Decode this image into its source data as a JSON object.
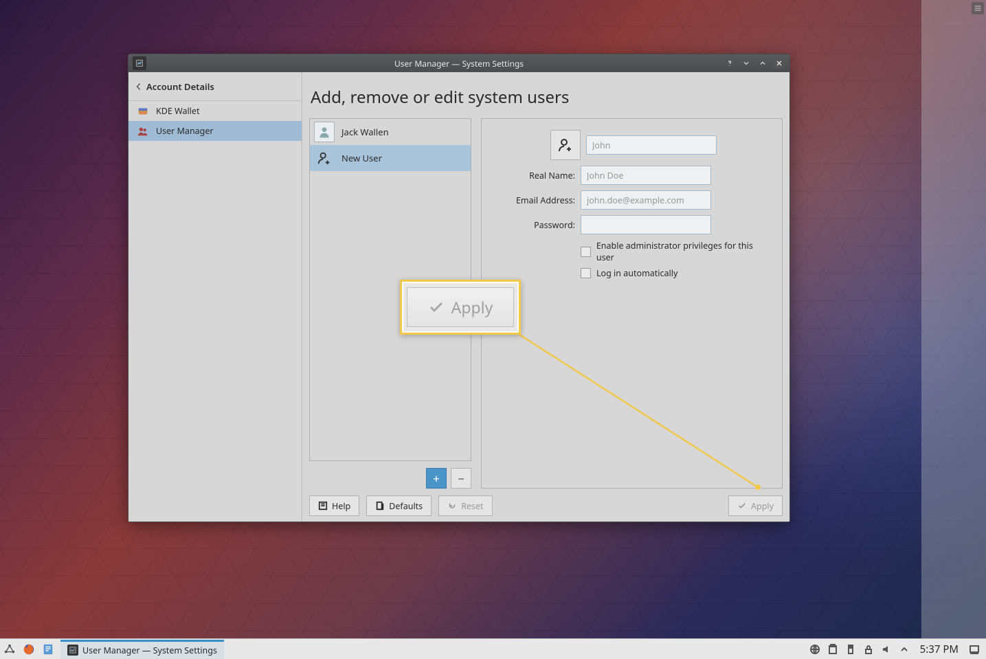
{
  "window": {
    "title": "User Manager — System Settings"
  },
  "sidebar": {
    "back_label": "Account Details",
    "items": [
      {
        "label": "KDE Wallet",
        "icon": "wallet"
      },
      {
        "label": "User Manager",
        "icon": "users"
      }
    ]
  },
  "page": {
    "heading": "Add, remove or edit system users"
  },
  "users": [
    {
      "name": "Jack Wallen",
      "kind": "existing"
    },
    {
      "name": "New User",
      "kind": "new"
    }
  ],
  "form": {
    "username_placeholder": "John",
    "realname_label": "Real Name:",
    "realname_placeholder": "John Doe",
    "email_label": "Email Address:",
    "email_placeholder": "john.doe@example.com",
    "password_label": "Password:",
    "admin_label": "Enable administrator privileges for this user",
    "autologin_label": "Log in automatically"
  },
  "buttons": {
    "help": "Help",
    "defaults": "Defaults",
    "reset": "Reset",
    "apply": "Apply",
    "add": "+",
    "remove": "−"
  },
  "callout": {
    "label": "Apply"
  },
  "taskbar": {
    "entry": "User Manager  — System Settings",
    "clock": "5:37 PM"
  }
}
